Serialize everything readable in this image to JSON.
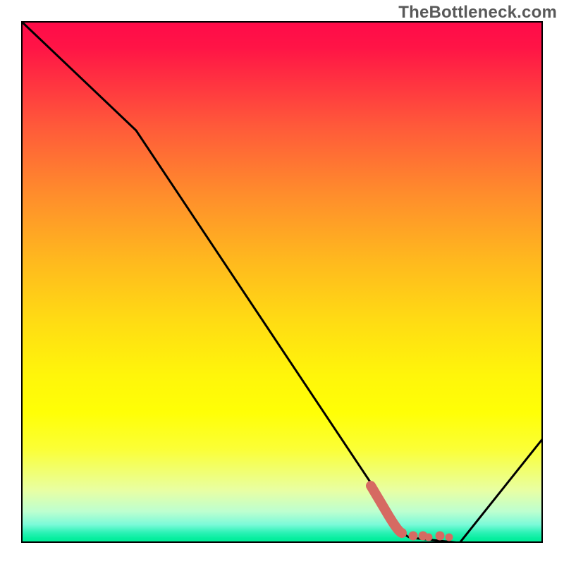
{
  "watermark": "TheBottleneck.com",
  "chart_data": {
    "type": "line",
    "title": "",
    "xlabel": "",
    "ylabel": "",
    "xlim": [
      0,
      100
    ],
    "ylim": [
      0,
      100
    ],
    "series": [
      {
        "name": "bottleneck-curve",
        "x": [
          0,
          22,
          70,
          73,
          84,
          100
        ],
        "y": [
          100,
          79,
          7,
          1,
          0,
          20
        ],
        "color": "#000000"
      },
      {
        "name": "highlight-segment",
        "x": [
          67,
          70,
          72,
          73,
          75,
          77,
          78,
          80,
          82
        ],
        "y": [
          11,
          6,
          3,
          2,
          1.3,
          1.3,
          1.1,
          1.3,
          1.1
        ],
        "color": "#d66a62"
      }
    ],
    "grid": false,
    "legend": false
  },
  "colors": {
    "gradient_top": "#ff0b49",
    "gradient_bottom": "#00ed98",
    "curve": "#000000",
    "highlight": "#d66a62",
    "frame": "#000000",
    "watermark": "#595959"
  }
}
